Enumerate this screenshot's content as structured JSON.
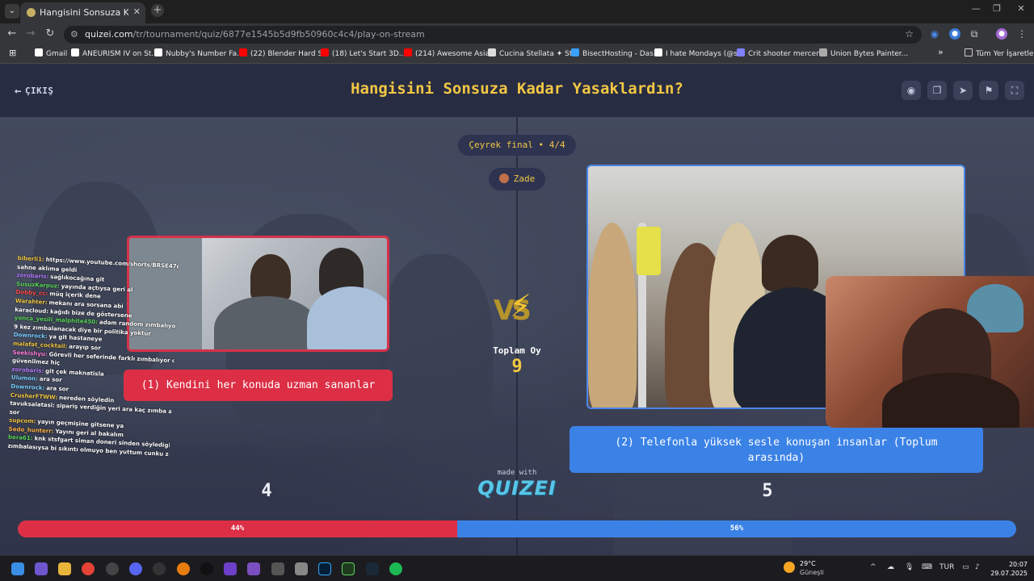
{
  "browser": {
    "tab_title": "Hangisini Sonsuza Kadar Yasakla",
    "tab_close": "✕",
    "new_tab": "+",
    "url_host": "quizei.com",
    "url_path": "/tr/tournament/quiz/6877e1545b5d9fb50960c4c4/play-on-stream",
    "bookmarks": [
      {
        "label": "Gmail",
        "color": "#ffffff"
      },
      {
        "label": "ANEURISM IV on St...",
        "color": "#ffffff"
      },
      {
        "label": "Nubby's Number Fa...",
        "color": "#ffffff"
      },
      {
        "label": "(22) Blender Hard S...",
        "color": "#ff0000"
      },
      {
        "label": "(18) Let's Start 3D...",
        "color": "#ff0000"
      },
      {
        "label": "(214) Awesome Asia...",
        "color": "#ff0000"
      },
      {
        "label": "Cucina Stellata ✦ St...",
        "color": "#dddddd"
      },
      {
        "label": "BisectHosting - Das...",
        "color": "#3aa0ff"
      },
      {
        "label": "I hate Mondays (@s...",
        "color": "#ffffff"
      },
      {
        "label": "Crit shooter mercen...",
        "color": "#8080ff"
      },
      {
        "label": "Union Bytes Painter...",
        "color": "#aaaaaa"
      }
    ],
    "bookmarks_more": "»",
    "all_bookmarks": "Tüm Yer İşaretleri"
  },
  "page": {
    "exit_label": "ÇIKIŞ",
    "title": "Hangisini Sonsuza Kadar Yasaklardın?",
    "stage": "Çeyrek final • 4/4",
    "user": "Zade",
    "option1_label": "(1) Kendini her konuda uzman sananlar",
    "option2_label": "(2) Telefonla yüksek sesle konuşan insanlar (Toplum arasında)",
    "total_label": "Toplam Oy",
    "total_votes": "9",
    "option1_votes": "4",
    "option2_votes": "5",
    "option1_percent_label": "44%",
    "option2_percent_label": "56%",
    "option1_fraction": 0.44,
    "made_with": "made with",
    "logo": "QUIZEI",
    "colors": {
      "title": "#f2c744",
      "option1": "#dc2f45",
      "option2": "#3b82e6"
    }
  },
  "chat": [
    {
      "user": "biberli1:",
      "color": "#f2c744",
      "text": "https://www.youtube.com/shorts/BRSE47q1WA bu"
    },
    {
      "user": "",
      "color": "#ffffff",
      "text": "sahne aklıma geldi"
    },
    {
      "user": "zorobaris:",
      "color": "#b57cff",
      "text": "sağlıkocağına git"
    },
    {
      "user": "SusuzKarpuz:",
      "color": "#5bd65b",
      "text": "yayında açtıysa geri al"
    },
    {
      "user": "Dobby_cc:",
      "color": "#ff4d4d",
      "text": "müq içerik dene"
    },
    {
      "user": "Warahter:",
      "color": "#f2c744",
      "text": "mekanı ara sorsana abi"
    },
    {
      "user": "karacloud:",
      "color": "#ffffff",
      "text": "kağıdı bize de göstersene"
    },
    {
      "user": "yonca_yesili_malphite450:",
      "color": "#5bd65b",
      "text": "adam random zımbalıyordur belki"
    },
    {
      "user": "",
      "color": "#ffffff",
      "text": "9 kez zımbalanacak diye bir politika yoktur"
    },
    {
      "user": "Downrock:",
      "color": "#7ad0ff",
      "text": "ya git hastaneye"
    },
    {
      "user": "malafat_cocktail:",
      "color": "#f2c744",
      "text": "arayıp sor"
    },
    {
      "user": "Seekishyu:",
      "color": "#ff7ad9",
      "text": "Görevli her seferinde farklı zımbalıyor ona"
    },
    {
      "user": "",
      "color": "#ffffff",
      "text": "güvenilmez hiç"
    },
    {
      "user": "zorobaris:",
      "color": "#b57cff",
      "text": "git çek maknatisla"
    },
    {
      "user": "Ulumon:",
      "color": "#7ad0ff",
      "text": "ara sor"
    },
    {
      "user": "Downrock:",
      "color": "#7ad0ff",
      "text": "ara sor"
    },
    {
      "user": "CrusherFTWW:",
      "color": "#f2c744",
      "text": "nereden söyledin"
    },
    {
      "user": "tavuksalatasi:",
      "color": "#ffffff",
      "text": "sipariş verdiğin yeri ara kaç zımba atılmış diye"
    },
    {
      "user": "",
      "color": "#ffffff",
      "text": "sor"
    },
    {
      "user": "supcom:",
      "color": "#f2c744",
      "text": "yayın geçmişine gitsene ya"
    },
    {
      "user": "Sedo_hunterr:",
      "color": "#ffb347",
      "text": "Yayını geri al bakalım"
    },
    {
      "user": "bera61:",
      "color": "#5bd65b",
      "text": "knk stsfgart siman doneri sinden söyledigin palalesin"
    },
    {
      "user": "",
      "color": "#ffffff",
      "text": "zımbalasıysa bi sıkıntı olmuyo ben yuttum cunku zamanında"
    }
  ],
  "taskbar": {
    "weather_temp": "29°C",
    "weather_desc": "Güneşli",
    "weather_badge": "1",
    "lang": "TUR",
    "time": "20:07",
    "date": "29.07.2025"
  }
}
